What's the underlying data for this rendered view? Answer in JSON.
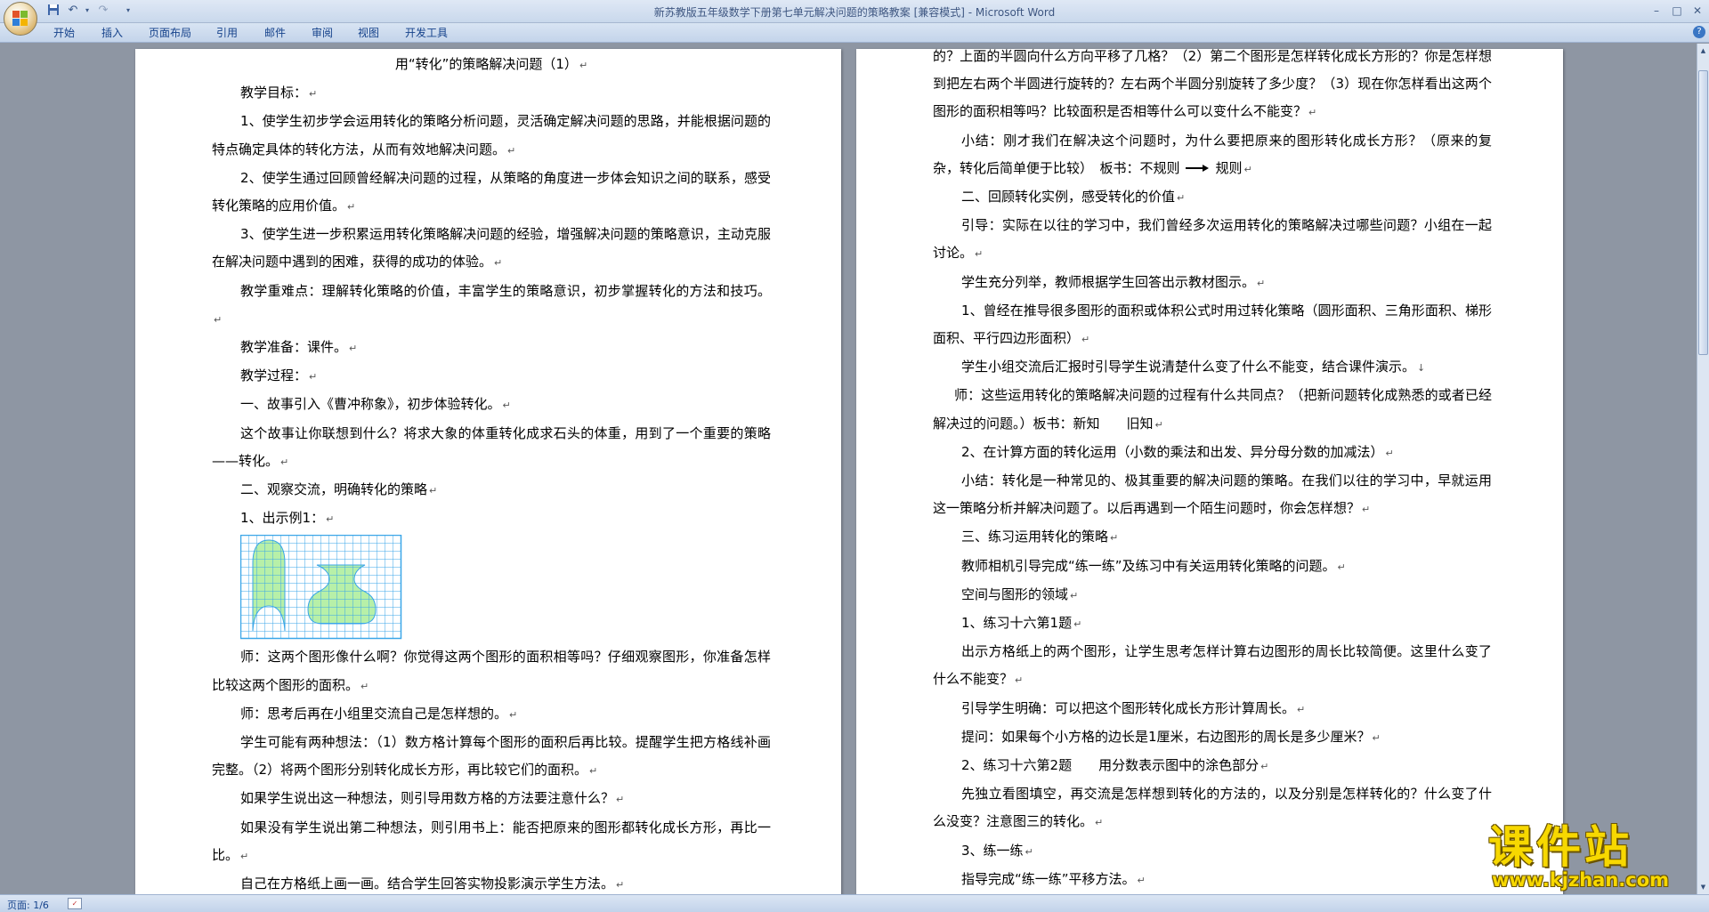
{
  "window": {
    "title": "新苏教版五年级数学下册第七单元解决问题的策略教案 [兼容模式] - Microsoft Word",
    "minimize": "–",
    "maximize": "□",
    "close": "✕"
  },
  "quick_access": {
    "save_icon": "save-icon",
    "undo_icon": "undo-icon",
    "redo_icon": "redo-icon",
    "customize_icon": "dropdown-icon"
  },
  "ribbon": {
    "tabs": [
      "开始",
      "插入",
      "页面布局",
      "引用",
      "邮件",
      "审阅",
      "视图",
      "开发工具"
    ]
  },
  "document": {
    "left_page": [
      "用“转化”的策略解决问题（1）",
      "教学目标：",
      "1、使学生初步学会运用转化的策略分析问题，灵活确定解决问题的思路，并能根据问题的特点确定具体的转化方法，从而有效地解决问题。",
      "2、使学生通过回顾曾经解决问题的过程，从策略的角度进一步体会知识之间的联系，感受转化策略的应用价值。",
      "3、使学生进一步积累运用转化策略解决问题的经验，增强解决问题的策略意识，主动克服在解决问题中遇到的困难，获得的成功的体验。",
      "教学重难点：理解转化策略的价值，丰富学生的策略意识，初步掌握转化的方法和技巧。",
      "教学准备：课件。",
      "教学过程：",
      "一、故事引入《曹冲称象》，初步体验转化。",
      "这个故事让你联想到什么？将求大象的体重转化成求石头的体重，用到了一个重要的策略——转化。",
      "二、观察交流，明确转化的策略",
      "1、出示例1：",
      "师：这两个图形像什么啊？你觉得这两个图形的面积相等吗？仔细观察图形，你准备怎样比较这两个图形的面积。",
      "师：思考后再在小组里交流自己是怎样想的。",
      "学生可能有两种想法：（1）数方格计算每个图形的面积后再比较。提醒学生把方格线补画完整。（2）将两个图形分别转化成长方形，再比较它们的面积。",
      "如果学生说出这一种想法，则引导用数方格的方法要注意什么？",
      "如果没有学生说出第二种想法，则引用书上：能否把原来的图形都转化成长方形，再比一比。",
      "自己在方格纸上画一画。结合学生回答实物投影演示学生方法。"
    ],
    "right_page": [
      "的？上面的半圆向什么方向平移了几格？（2）第二个图形是怎样转化成长方形的？你是怎样想到把左右两个半圆进行旋转的？左右两个半圆分别旋转了多少度？（3）现在你怎样看出这两个图形的面积相等吗？比较面积是否相等什么可以变什么不能变？",
      "小结：刚才我们在解决这个问题时，为什么要把原来的图形转化成长方形？（原来的复杂，转化后简单便于比较）　板书：不规则",
      "规则",
      "二、回顾转化实例，感受转化的价值",
      "引导：实际在以往的学习中，我们曾经多次运用转化的策略解决过哪些问题？小组在一起讨论。",
      "学生充分列举，教师根据学生回答出示教材图示。",
      "1、曾经在推导很多图形的面积或体积公式时用过转化策略（圆形面积、三角形面积、梯形面积、平行四边形面积）",
      "学生小组交流后汇报时引导学生说清楚什么变了什么不能变，结合课件演示。",
      "师：这些运用转化的策略解决问题的过程有什么共同点？（把新问题转化成熟悉的或者已经解决过的问题。）板书：新知　　旧知",
      "2、在计算方面的转化运用（小数的乘法和出发、异分母分数的加减法）",
      "小结：转化是一种常见的、极其重要的解决问题的策略。在我们以往的学习中，早就运用这一策略分析并解决问题了。以后再遇到一个陌生问题时，你会怎样想？",
      "三、练习运用转化的策略",
      "教师相机引导完成“练一练”及练习中有关运用转化策略的问题。",
      "空间与图形的领域",
      "1、练习十六第1题",
      "出示方格纸上的两个图形，让学生思考怎样计算右边图形的周长比较简便。这里什么变了什么不能变？",
      "引导学生明确：可以把这个图形转化成长方形计算周长。",
      "提问：如果每个小方格的边长是1厘米，右边图形的周长是多少厘米？",
      "2、练习十六第2题　　用分数表示图中的涂色部分",
      "先独立看图填空，再交流是怎样想到转化的方法的，以及分别是怎样转化的？什么变了什么没变？注意图三的转化。",
      "3、练一练",
      "指导完成“练一练”平移方法。"
    ]
  },
  "statusbar": {
    "page_info": "页面: 1/6"
  },
  "watermark": {
    "title": "课件站",
    "url": "www.kjzhan.com"
  },
  "colors": {
    "figure_grid": "#3aa6e8",
    "figure_fill": "#b7f0a8",
    "ribbon_text": "#15428b",
    "watermark": "#f7d800"
  }
}
